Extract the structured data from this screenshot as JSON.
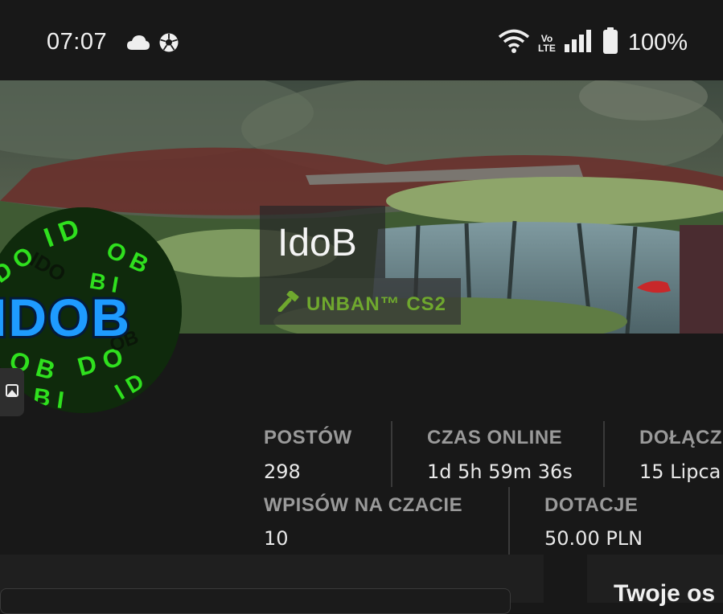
{
  "status_bar": {
    "time": "07:07",
    "left_icons": [
      "cloud-icon",
      "soccer-ball-icon"
    ],
    "right_icons": [
      "wifi-icon",
      "volte-icon",
      "signal-icon",
      "battery-icon"
    ],
    "volte_line1": "Vo",
    "volte_line2": "LTE",
    "battery_percent": "100%"
  },
  "profile": {
    "username": "IdoB",
    "rank": "UNBAN™ CS2",
    "rank_icon": "gavel-icon",
    "rank_color": "#6fa82e"
  },
  "stats": {
    "posts_label": "POSTÓW",
    "posts_value": "298",
    "online_label": "CZAS ONLINE",
    "online_value": "1d 5h 59m 36s",
    "joined_label": "DOŁĄCZ",
    "joined_value": "15 Lipca",
    "chat_label": "WPISÓW NA CZACIE",
    "chat_value": "10",
    "donations_label": "DOTACJE",
    "donations_value": "50.00 PLN"
  },
  "bottom": {
    "right_title": "Twoje os"
  }
}
